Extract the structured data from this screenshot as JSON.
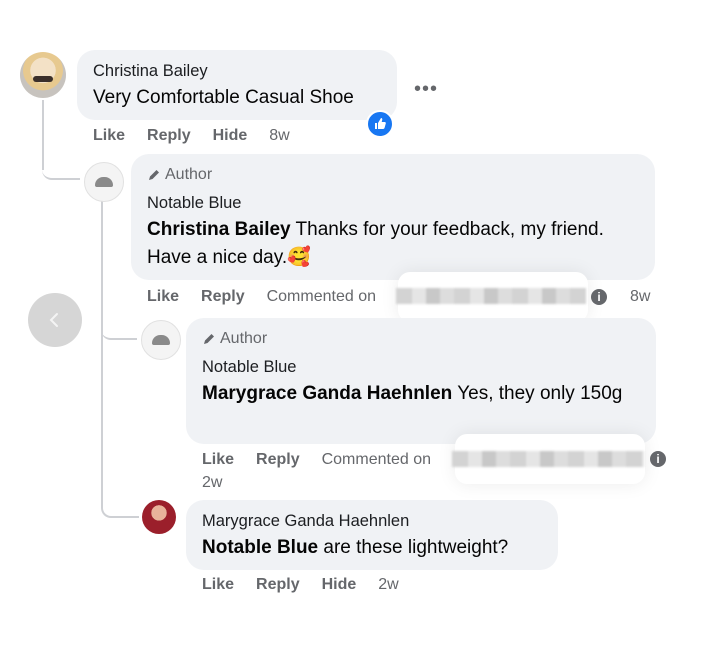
{
  "comment1": {
    "author": "Christina Bailey",
    "text": "Very Comfortable Casual Shoe",
    "actions": {
      "like": "Like",
      "reply": "Reply",
      "hide": "Hide",
      "time": "8w"
    },
    "more": "•••"
  },
  "reply1": {
    "tag": "Author",
    "author": "Notable Blue",
    "mention": "Christina Bailey",
    "text": " Thanks for your feedback, my friend. Have a nice day.🥰",
    "actions": {
      "like": "Like",
      "reply": "Reply",
      "commented": "Commented on",
      "time": "8w"
    }
  },
  "reply2": {
    "tag": "Author",
    "author": "Notable Blue",
    "mention": "Marygrace Ganda Haehnlen",
    "text": " Yes, they only 150g",
    "actions": {
      "like": "Like",
      "reply": "Reply",
      "commented": "Commented on",
      "time": "2w"
    }
  },
  "reply3": {
    "author": "Marygrace Ganda Haehnlen",
    "mention": "Notable Blue",
    "text": " are these lightweight?",
    "actions": {
      "like": "Like",
      "reply": "Reply",
      "hide": "Hide",
      "time": "2w"
    }
  },
  "colors": {
    "bubble": "#f0f2f5",
    "meta": "#65676b",
    "like_blue": "#1877f2"
  }
}
